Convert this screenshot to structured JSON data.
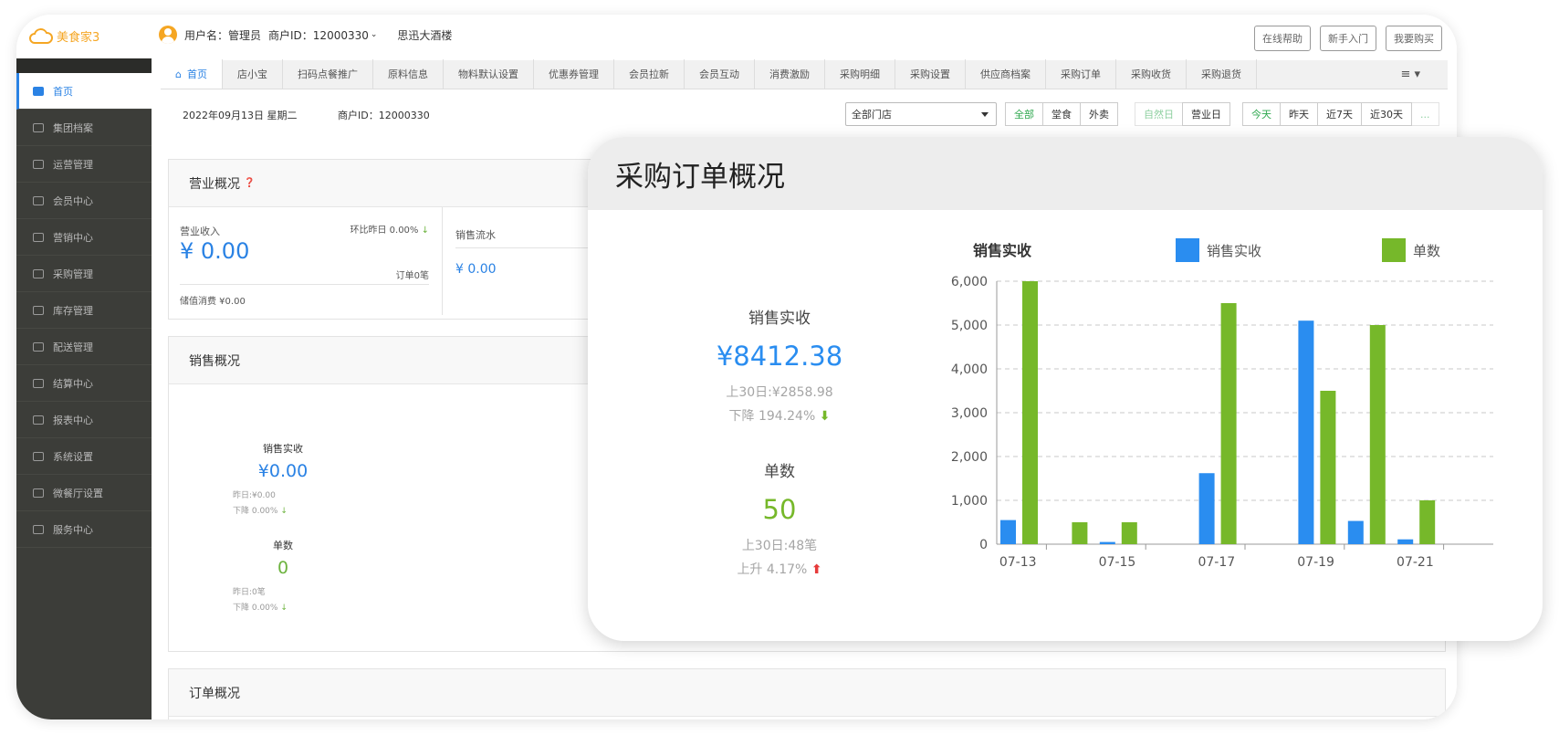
{
  "app": {
    "logo_text": "美食家3"
  },
  "header": {
    "user_label": "用户名：管理员",
    "merchant_label": "商户ID：12000330",
    "store_name": "思迅大酒楼",
    "buttons": [
      "在线帮助",
      "新手入门",
      "我要购买"
    ]
  },
  "sidebar": {
    "items": [
      {
        "label": "首页",
        "icon": "home-icon"
      },
      {
        "label": "集团档案",
        "icon": "file-icon"
      },
      {
        "label": "运营管理",
        "icon": "bar-chart-icon"
      },
      {
        "label": "会员中心",
        "icon": "card-icon"
      },
      {
        "label": "营销中心",
        "icon": "edit-icon"
      },
      {
        "label": "采购管理",
        "icon": "book-icon"
      },
      {
        "label": "库存管理",
        "icon": "storage-icon"
      },
      {
        "label": "配送管理",
        "icon": "truck-icon"
      },
      {
        "label": "结算中心",
        "icon": "bitcoin-icon"
      },
      {
        "label": "报表中心",
        "icon": "report-icon"
      },
      {
        "label": "系统设置",
        "icon": "gear-icon"
      },
      {
        "label": "微餐厅设置",
        "icon": "cutlery-icon"
      },
      {
        "label": "服务中心",
        "icon": "service-icon"
      }
    ]
  },
  "tabs": [
    "首页",
    "店小宝",
    "扫码点餐推广",
    "原料信息",
    "物料默认设置",
    "优惠券管理",
    "会员拉新",
    "会员互动",
    "消费激励",
    "采购明细",
    "采购设置",
    "供应商档案",
    "采购订单",
    "采购收货",
    "采购退货"
  ],
  "filter": {
    "date": "2022年09月13日 星期二",
    "merchant": "商户ID：12000330",
    "store_select": "全部门店",
    "channel": [
      "全部",
      "堂食",
      "外卖"
    ],
    "daytype": [
      "自然日",
      "营业日"
    ],
    "range": [
      "今天",
      "昨天",
      "近7天",
      "近30天",
      "..."
    ]
  },
  "business": {
    "title": "营业概况",
    "revenue_label": "营业收入",
    "revenue_value": "¥ 0.00",
    "compare": "环比昨日 0.00%",
    "orders": "订单0笔",
    "stored_value": "储值消费 ¥0.00",
    "sales_flow_label": "销售流水",
    "sales_flow_value": "¥ 0.00"
  },
  "sales": {
    "title": "销售概况",
    "actual_label": "销售实收",
    "actual_value": "¥0.00",
    "actual_prev": "昨日:¥0.00",
    "actual_change": "下降 0.00%",
    "count_label": "单数",
    "count_value": "0",
    "count_prev": "昨日:0笔",
    "count_change": "下降 0.00%"
  },
  "orders_overview": {
    "title": "订单概况"
  },
  "card": {
    "title": "采购订单概况",
    "actual_label": "销售实收",
    "actual_value": "¥8412.38",
    "actual_prev": "上30日:¥2858.98",
    "actual_change": "下降 194.24%",
    "count_label": "单数",
    "count_value": "50",
    "count_prev": "上30日:48笔",
    "count_change": "上升 4.17%"
  },
  "colors": {
    "blue": "#2a8df0",
    "green": "#76b82a",
    "red": "#e63a3a",
    "accent": "#2a82e4"
  },
  "chart_data": {
    "type": "bar",
    "title": "销售实收",
    "categories": [
      "07-13",
      "07-14",
      "07-15",
      "07-16",
      "07-17",
      "07-18",
      "07-19",
      "07-20",
      "07-21",
      "07-22"
    ],
    "tick_labels": [
      "07-13",
      "07-15",
      "07-17",
      "07-19",
      "07-21"
    ],
    "series": [
      {
        "name": "销售实收",
        "values": [
          550,
          0,
          50,
          0,
          1620,
          0,
          5100,
          530,
          110,
          0
        ]
      },
      {
        "name": "单数",
        "values": [
          6000,
          500,
          500,
          0,
          5500,
          0,
          3500,
          5000,
          1000,
          0
        ]
      }
    ],
    "ylim": [
      0,
      6000
    ],
    "yticks": [
      "0",
      "1,000",
      "2,000",
      "3,000",
      "4,000",
      "5,000",
      "6,000"
    ],
    "grid": true,
    "legend": "top-right"
  }
}
